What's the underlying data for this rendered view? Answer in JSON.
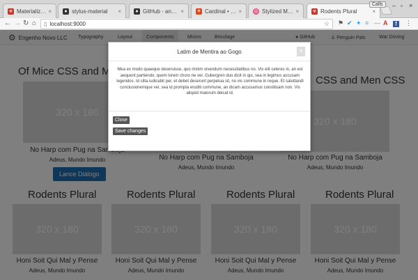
{
  "browser": {
    "tabs": [
      {
        "title": "Materialized Sty",
        "icon": "biohazard-icon",
        "color": "#c0392b"
      },
      {
        "title": "stylus-material",
        "icon": "github-icon",
        "color": "#333333"
      },
      {
        "title": "GitHub - angel",
        "icon": "github-icon",
        "color": "#333333"
      },
      {
        "title": "Cardinal • Build",
        "icon": "cardinal-icon",
        "color": "#d94a1e"
      },
      {
        "title": "Stylized Matter",
        "icon": "dribbble-icon",
        "color": "#ea4c89"
      },
      {
        "title": "Rodents Plural",
        "icon": "biohazard-icon",
        "color": "#c0392b"
      }
    ],
    "profile": "Calls",
    "url": "localhost:9000"
  },
  "site": {
    "brand": "Engenho Novo LLC",
    "nav": [
      "Typography",
      "Layout",
      "Components",
      "Mixins",
      "Bricolage"
    ],
    "nav_right": [
      "GitHub",
      "Penguin Pals",
      "War Driving"
    ]
  },
  "content": {
    "row1_heading_left": "Of Mice CSS and Me",
    "row1_heading_right": "CSS and Men CSS",
    "placeholder": "320 x 180",
    "row1_caption": "No Harp com Pug na Samboja",
    "row1_sub": "Adeus, Mundo Imundo",
    "launch_button": "Lance Diálogo",
    "row2_heading": "Rodents Plural",
    "row2_caption": "Honi Soit Qui Mal y Pense",
    "row2_sub": "Adeus, Mundo Imundo"
  },
  "modal": {
    "title": "Latim de Mentira ao Gogo",
    "close_x": "×",
    "body": "Mea ex modo quaeque deseruisse, quo minim vivendum necessitatibus no. Vix elit celeres in, an est aequent partiendo, quem lorem choro ne vel. Gubergren duo dicit in qui, sea in legimus accusam legendos. Id clita iudicabit per, et debet deserunt perpetua sit, no vis commune in reque. Et saluttandi conclusionemque vel, sea id prompta eruditi commune, an dicam accusamus constituam non. Vis aliquid maiorum deicat id.",
    "close_button": "Close",
    "save_button": "Save changes"
  }
}
